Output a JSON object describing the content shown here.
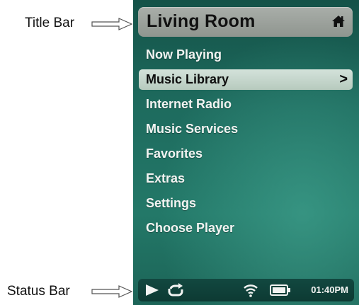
{
  "annotations": {
    "title_bar_label": "Title Bar",
    "status_bar_label": "Status Bar"
  },
  "title_bar": {
    "room_name": "Living Room",
    "icon": "home-icon"
  },
  "menu": {
    "items": [
      {
        "label": "Now Playing",
        "selected": false
      },
      {
        "label": "Music Library",
        "selected": true,
        "chevron": ">"
      },
      {
        "label": "Internet Radio",
        "selected": false
      },
      {
        "label": "Music Services",
        "selected": false
      },
      {
        "label": "Favorites",
        "selected": false
      },
      {
        "label": "Extras",
        "selected": false
      },
      {
        "label": "Settings",
        "selected": false
      },
      {
        "label": "Choose Player",
        "selected": false
      }
    ]
  },
  "status_bar": {
    "play_state_icon": "play-icon",
    "repeat_icon": "repeat-icon",
    "wifi_icon": "wifi-icon",
    "battery_icon": "battery-icon",
    "time": "01:40PM"
  },
  "colors": {
    "screen_top": "#145248",
    "screen_bottom": "#237868",
    "title_bar": "#9fa59f",
    "selected_row": "#c7d7ce"
  }
}
